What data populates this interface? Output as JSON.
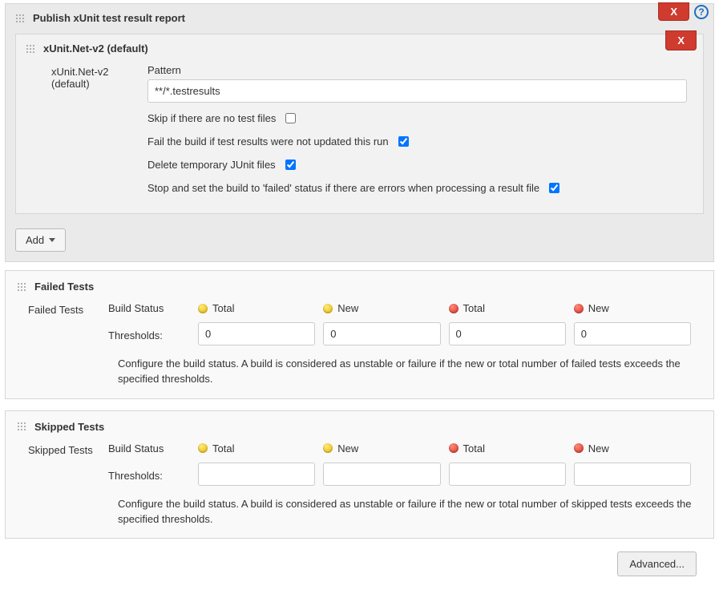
{
  "outer": {
    "title": "Publish xUnit test result report",
    "delete_label": "X"
  },
  "inner": {
    "title": "xUnit.Net-v2 (default)",
    "row_label": "xUnit.Net-v2 (default)",
    "delete_label": "X",
    "pattern_label": "Pattern",
    "pattern_value": "**/*.testresults",
    "skip_label": "Skip if there are no test files",
    "skip_checked": false,
    "fail_label": "Fail the build if test results were not updated this run",
    "fail_checked": true,
    "delete_tmp_label": "Delete temporary JUnit files",
    "delete_tmp_checked": true,
    "stop_label": "Stop and set the build to 'failed' status if there are errors when processing a result file",
    "stop_checked": true
  },
  "add_label": "Add",
  "failed": {
    "title": "Failed Tests",
    "side_label": "Failed Tests",
    "build_status_label": "Build Status",
    "thresholds_label": "Thresholds:",
    "cols": {
      "y_total": "Total",
      "y_new": "New",
      "r_total": "Total",
      "r_new": "New"
    },
    "vals": {
      "y_total": "0",
      "y_new": "0",
      "r_total": "0",
      "r_new": "0"
    },
    "desc": "Configure the build status. A build is considered as unstable or failure if the new or total number of failed tests exceeds the specified thresholds."
  },
  "skipped": {
    "title": "Skipped Tests",
    "side_label": "Skipped Tests",
    "build_status_label": "Build Status",
    "thresholds_label": "Thresholds:",
    "cols": {
      "y_total": "Total",
      "y_new": "New",
      "r_total": "Total",
      "r_new": "New"
    },
    "vals": {
      "y_total": "",
      "y_new": "",
      "r_total": "",
      "r_new": ""
    },
    "desc": "Configure the build status. A build is considered as unstable or failure if the new or total number of skipped tests exceeds the specified thresholds."
  },
  "advanced_label": "Advanced..."
}
